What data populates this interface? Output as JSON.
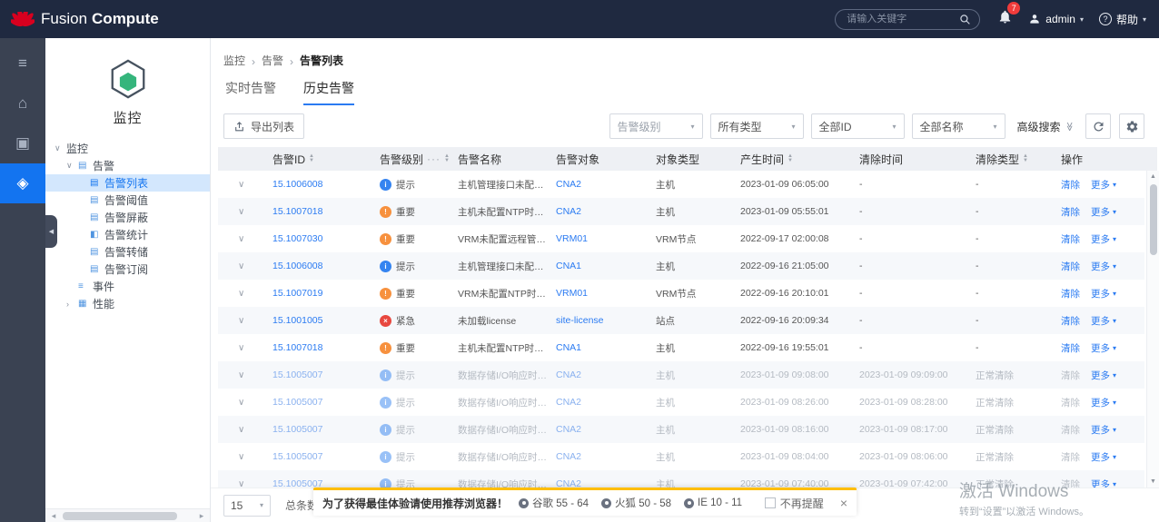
{
  "topbar": {
    "brand": {
      "fusion": "Fusion",
      "compute": "Compute"
    },
    "search": {
      "placeholder": "请输入关键字"
    },
    "notifications": {
      "badge": "7"
    },
    "user": {
      "label": "admin",
      "caret": "▾"
    },
    "help": {
      "label": "帮助",
      "caret": "▾",
      "icon_glyph": "?"
    }
  },
  "rail": {
    "items": [
      {
        "id": "menu",
        "icon": "menu-icon",
        "glyph": "≡",
        "active": false
      },
      {
        "id": "home",
        "icon": "home-icon",
        "glyph": "⌂",
        "active": false
      },
      {
        "id": "monitor",
        "icon": "monitor-icon",
        "glyph": "▣",
        "active": false
      },
      {
        "id": "resource",
        "icon": "cluster-icon",
        "glyph": "◈",
        "active": true
      }
    ],
    "collapse_glyph": "◀"
  },
  "sidebar": {
    "module": {
      "title": "监控"
    },
    "tree": [
      {
        "id": "monitor-root",
        "label": "监控",
        "indent": 0,
        "caret": "∨"
      },
      {
        "id": "alarm",
        "label": "告警",
        "indent": 1,
        "caret": "∨",
        "icon": "doc"
      },
      {
        "id": "alarm-list",
        "label": "告警列表",
        "indent": 2,
        "icon": "doc",
        "selected": true
      },
      {
        "id": "alarm-threshold",
        "label": "告警阈值",
        "indent": 2,
        "icon": "doc"
      },
      {
        "id": "alarm-mask",
        "label": "告警屏蔽",
        "indent": 2,
        "icon": "doc"
      },
      {
        "id": "alarm-stats",
        "label": "告警统计",
        "indent": 2,
        "icon": "chart"
      },
      {
        "id": "alarm-dump",
        "label": "告警转储",
        "indent": 2,
        "icon": "doc"
      },
      {
        "id": "alarm-subscription",
        "label": "告警订阅",
        "indent": 2,
        "icon": "doc"
      },
      {
        "id": "event",
        "label": "事件",
        "indent": 1,
        "icon": "list"
      },
      {
        "id": "performance",
        "label": "性能",
        "indent": 1,
        "caret": "›",
        "icon": "perf"
      }
    ],
    "scrollbar": {
      "left": "◂",
      "right": "▸"
    }
  },
  "breadcrumb": {
    "items": [
      "监控",
      "告警",
      "告警列表"
    ],
    "separator": "›"
  },
  "tabs": [
    {
      "id": "realtime",
      "label": "实时告警",
      "active": false
    },
    {
      "id": "history",
      "label": "历史告警",
      "active": true
    }
  ],
  "toolbar": {
    "export_label": "导出列表",
    "filters": [
      {
        "id": "level",
        "label": "告警级别",
        "placeholder": true
      },
      {
        "id": "type",
        "label": "所有类型",
        "placeholder": false
      },
      {
        "id": "id",
        "label": "全部ID",
        "placeholder": false
      },
      {
        "id": "name",
        "label": "全部名称",
        "placeholder": false
      }
    ],
    "filter_caret": "▾",
    "advanced_label": "高级搜索",
    "advanced_glyph": "≫"
  },
  "table": {
    "columns": [
      {
        "key": "expand",
        "label": "",
        "width": 52
      },
      {
        "key": "id",
        "label": "告警ID",
        "width": 118,
        "sortable": true
      },
      {
        "key": "level",
        "label": "告警级别",
        "width": 86,
        "sortable": true,
        "filter": true
      },
      {
        "key": "name",
        "label": "告警名称",
        "width": 108
      },
      {
        "key": "object",
        "label": "告警对象",
        "width": 110
      },
      {
        "key": "objtype",
        "label": "对象类型",
        "width": 93
      },
      {
        "key": "created",
        "label": "产生时间",
        "width": 131,
        "sortable": true
      },
      {
        "key": "cleared",
        "label": "清除时间",
        "width": 128
      },
      {
        "key": "cleartype",
        "label": "清除类型",
        "width": 94,
        "sortable": true
      },
      {
        "key": "actions",
        "label": "操作",
        "width": 100
      }
    ],
    "sort_up": "▲",
    "sort_down": "▼",
    "expand_glyph": "∨",
    "filter_dots": "···",
    "scrollbar": {
      "up": "▲",
      "down": "▼"
    },
    "actions": {
      "clear_label": "清除",
      "more_label": "更多",
      "more_caret": "▾"
    },
    "rows": [
      {
        "id": "15.1006008",
        "severity": "info",
        "severity_label": "提示",
        "name": "主机管理接口未配置...",
        "object": "CNA2",
        "objtype": "主机",
        "created": "2023-01-09 06:05:00",
        "cleared": "-",
        "cleartype": "-",
        "is_cleared": false
      },
      {
        "id": "15.1007018",
        "severity": "major",
        "severity_label": "重要",
        "name": "主机未配置NTP时钟源",
        "object": "CNA2",
        "objtype": "主机",
        "created": "2023-01-09 05:55:01",
        "cleared": "-",
        "cleartype": "-",
        "is_cleared": false
      },
      {
        "id": "15.1007030",
        "severity": "major",
        "severity_label": "重要",
        "name": "VRM未配置远程管理...",
        "object": "VRM01",
        "objtype": "VRM节点",
        "created": "2022-09-17 02:00:08",
        "cleared": "-",
        "cleartype": "-",
        "is_cleared": false
      },
      {
        "id": "15.1006008",
        "severity": "info",
        "severity_label": "提示",
        "name": "主机管理接口未配置...",
        "object": "CNA1",
        "objtype": "主机",
        "created": "2022-09-16 21:05:00",
        "cleared": "-",
        "cleartype": "-",
        "is_cleared": false
      },
      {
        "id": "15.1007019",
        "severity": "major",
        "severity_label": "重要",
        "name": "VRM未配置NTP时钟源",
        "object": "VRM01",
        "objtype": "VRM节点",
        "created": "2022-09-16 20:10:01",
        "cleared": "-",
        "cleartype": "-",
        "is_cleared": false
      },
      {
        "id": "15.1001005",
        "severity": "critical",
        "severity_label": "紧急",
        "name": "未加载license",
        "object": "site-license",
        "objtype": "站点",
        "created": "2022-09-16 20:09:34",
        "cleared": "-",
        "cleartype": "-",
        "is_cleared": false
      },
      {
        "id": "15.1007018",
        "severity": "major",
        "severity_label": "重要",
        "name": "主机未配置NTP时钟源",
        "object": "CNA1",
        "objtype": "主机",
        "created": "2022-09-16 19:55:01",
        "cleared": "-",
        "cleartype": "-",
        "is_cleared": false
      },
      {
        "id": "15.1005007",
        "severity": "info",
        "severity_label": "提示",
        "name": "数据存储I/O响应时延...",
        "object": "CNA2",
        "objtype": "主机",
        "created": "2023-01-09 09:08:00",
        "cleared": "2023-01-09 09:09:00",
        "cleartype": "正常清除",
        "is_cleared": true
      },
      {
        "id": "15.1005007",
        "severity": "info",
        "severity_label": "提示",
        "name": "数据存储I/O响应时延...",
        "object": "CNA2",
        "objtype": "主机",
        "created": "2023-01-09 08:26:00",
        "cleared": "2023-01-09 08:28:00",
        "cleartype": "正常清除",
        "is_cleared": true
      },
      {
        "id": "15.1005007",
        "severity": "info",
        "severity_label": "提示",
        "name": "数据存储I/O响应时延...",
        "object": "CNA2",
        "objtype": "主机",
        "created": "2023-01-09 08:16:00",
        "cleared": "2023-01-09 08:17:00",
        "cleartype": "正常清除",
        "is_cleared": true
      },
      {
        "id": "15.1005007",
        "severity": "info",
        "severity_label": "提示",
        "name": "数据存储I/O响应时延...",
        "object": "CNA2",
        "objtype": "主机",
        "created": "2023-01-09 08:04:00",
        "cleared": "2023-01-09 08:06:00",
        "cleartype": "正常清除",
        "is_cleared": true
      },
      {
        "id": "15.1005007",
        "severity": "info",
        "severity_label": "提示",
        "name": "数据存储I/O响应时延...",
        "object": "CNA2",
        "objtype": "主机",
        "created": "2023-01-09 07:40:00",
        "cleared": "2023-01-09 07:42:00",
        "cleartype": "正常清除",
        "is_cleared": true
      }
    ]
  },
  "severity_styles": {
    "info": {
      "color": "#3584f0",
      "glyph": "i"
    },
    "major": {
      "color": "#f7913e",
      "glyph": "!"
    },
    "critical": {
      "color": "#e8483f",
      "glyph": "×"
    }
  },
  "footer": {
    "page_size": "15",
    "page_caret": "▾",
    "total_label": "总条数"
  },
  "banner": {
    "accent": "#ffbe00",
    "message": "为了获得最佳体验请使用推荐浏览器！",
    "browsers": [
      {
        "id": "chrome",
        "label": "谷歌 55 - 64"
      },
      {
        "id": "firefox",
        "label": "火狐 50 - 58"
      },
      {
        "id": "ie",
        "label": "IE 10 - 11"
      }
    ],
    "dismiss_label": "不再提醒",
    "close_glyph": "×"
  },
  "watermark": {
    "line1": "激活 Windows",
    "line2": "转到“设置”以激活 Windows。"
  }
}
